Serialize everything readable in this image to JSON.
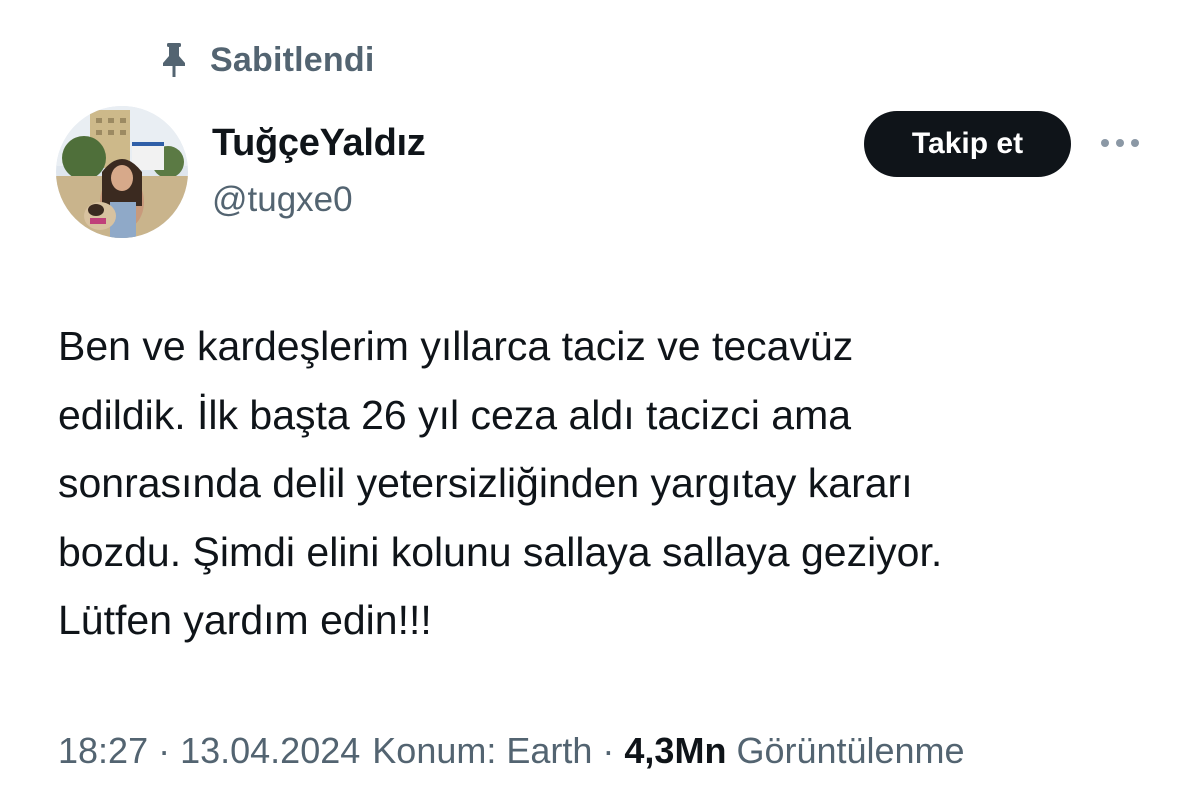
{
  "pinned": {
    "label": "Sabitlendi",
    "icon": "pin-icon"
  },
  "author": {
    "display_name": "TuğçeYaldız",
    "handle": "@tugxe0",
    "avatar_icon": "profile-photo"
  },
  "actions": {
    "follow_label": "Takip et",
    "more_icon": "more-horizontal-icon"
  },
  "tweet": {
    "lines": [
      "Ben ve kardeşlerim yıllarca taciz ve tecavüz",
      "edildik. İlk başta 26 yıl ceza aldı tacizci ama",
      "sonrasında delil yetersizliğinden yargıtay kararı",
      "bozdu. Şimdi elini kolunu sallaya sallaya geziyor.",
      "Lütfen yardım edin!!!"
    ]
  },
  "meta": {
    "time": "18:27",
    "separator": "·",
    "date": "13.04.2024",
    "location": "Konum: Earth",
    "views_count": "4,3Mn",
    "views_label": "Görüntülenme"
  },
  "colors": {
    "primary_text": "#0f1419",
    "secondary_text": "#536471",
    "button_bg": "#0f1419",
    "button_text": "#ffffff",
    "background": "#ffffff"
  }
}
